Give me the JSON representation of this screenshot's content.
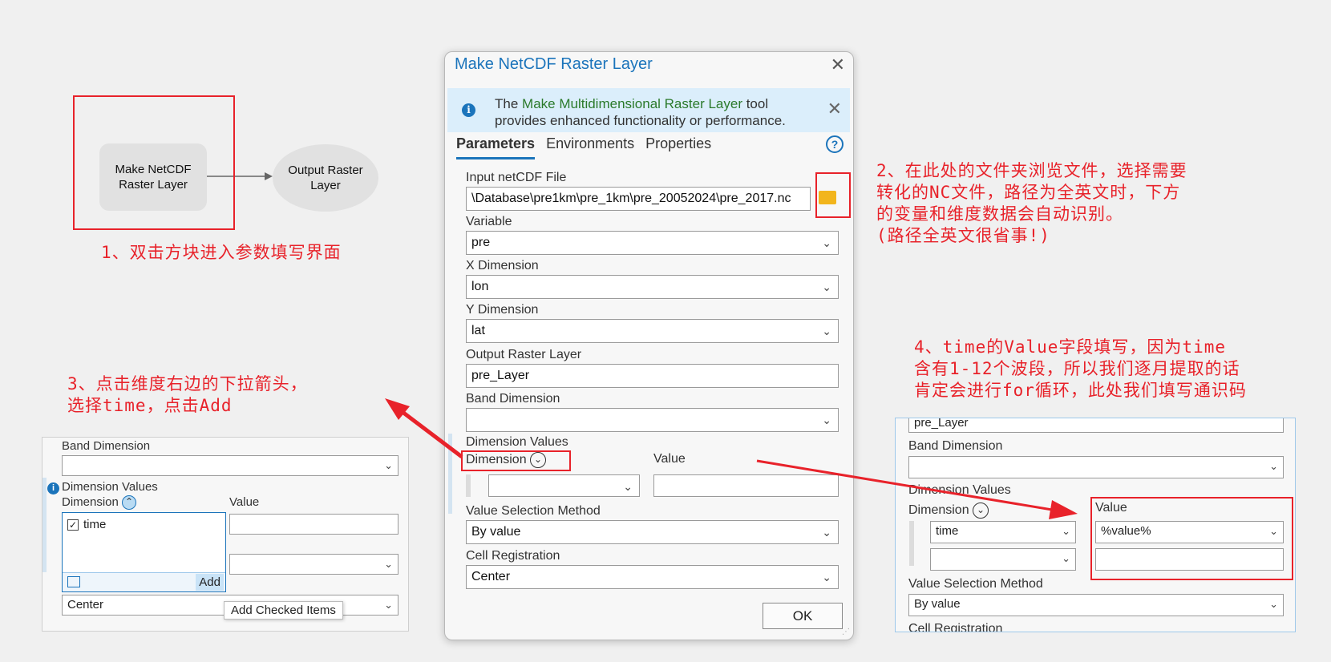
{
  "model_builder": {
    "tool_node": "Make NetCDF\nRaster Layer",
    "output_node": "Output Raster\nLayer"
  },
  "annotations": {
    "step1": "1、双击方块进入参数填写界面",
    "step2": "2、在此处的文件夹浏览文件，选择需要\n转化的NC文件，路径为全英文时，下方\n的变量和维度数据会自动识别。\n(路径全英文很省事!)",
    "step3": "3、点击维度右边的下拉箭头，\n选择time，点击Add",
    "step4": "4、time的Value字段填写，因为time\n含有1-12个波段，所以我们逐月提取的话\n肯定会进行for循环，此处我们填写通识码"
  },
  "dialog": {
    "title": "Make NetCDF Raster Layer",
    "info_prefix": "The ",
    "info_link": "Make Multidimensional Raster Layer",
    "info_suffix": " tool provides enhanced functionality or performance.",
    "tabs": [
      "Parameters",
      "Environments",
      "Properties"
    ],
    "help_icon": "?",
    "input_netcdf_label": "Input netCDF File",
    "input_netcdf_value": "\\Database\\pre1km\\pre_1km\\pre_20052024\\pre_2017.nc",
    "variable_label": "Variable",
    "variable_value": "pre",
    "x_dim_label": "X Dimension",
    "x_dim_value": "lon",
    "y_dim_label": "Y Dimension",
    "y_dim_value": "lat",
    "output_label": "Output Raster Layer",
    "output_value": "pre_Layer",
    "band_dim_label": "Band Dimension",
    "band_dim_value": "",
    "dim_values_label": "Dimension Values",
    "dimension_col": "Dimension",
    "value_col": "Value",
    "value_sel_label": "Value Selection Method",
    "value_sel_value": "By value",
    "cell_reg_label": "Cell Registration",
    "cell_reg_value": "Center",
    "ok": "OK"
  },
  "snippet_left": {
    "band_dim_label": "Band Dimension",
    "dim_values_label": "Dimension Values",
    "dimension_col": "Dimension",
    "value_col": "Value",
    "checked_item": "time",
    "add_button": "Add",
    "cell_reg_value": "Center",
    "tooltip": "Add Checked Items"
  },
  "snippet_right": {
    "output_value": "pre_Layer",
    "band_dim_label": "Band Dimension",
    "dim_values_label": "Dimension Values",
    "dimension_col": "Dimension",
    "value_col": "Value",
    "row1_dim": "time",
    "row1_value": "%value%",
    "value_sel_label": "Value Selection Method",
    "value_sel_value": "By value",
    "cell_reg_label": "Cell Registration"
  },
  "colors": {
    "annotation": "#e8222a",
    "accent": "#1b74bb",
    "info_link": "#2b7a2b"
  }
}
